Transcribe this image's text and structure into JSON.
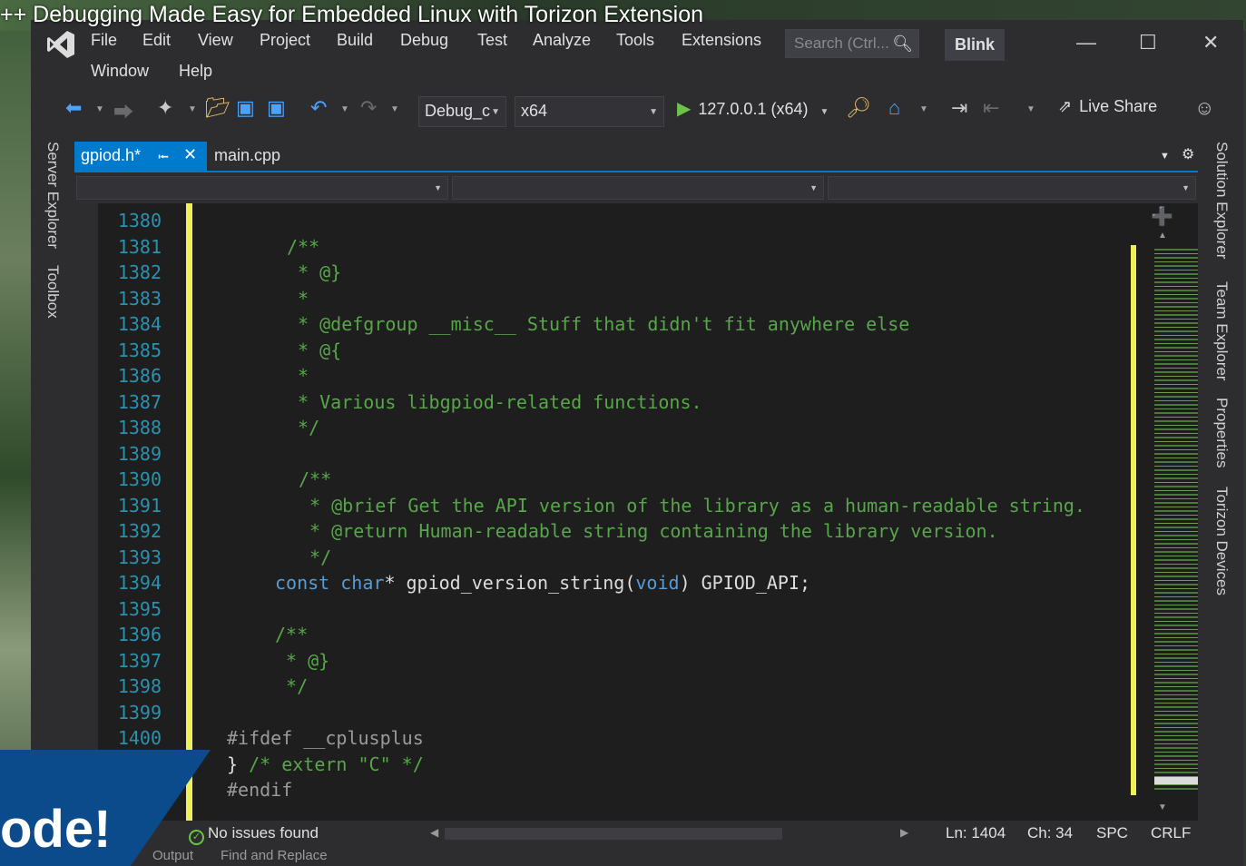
{
  "video": {
    "title": "++ Debugging Made Easy for Embedded Linux with Torizon Extension",
    "overlay_text": "ode!"
  },
  "menu": {
    "row1": [
      "File",
      "Edit",
      "View",
      "Project",
      "Build",
      "Debug",
      "Test",
      "Analyze",
      "Tools",
      "Extensions"
    ],
    "row2": [
      "Window",
      "Help"
    ]
  },
  "search": {
    "placeholder": "Search (Ctrl..."
  },
  "solution_name": "Blink",
  "toolbar": {
    "config": "Debug_c",
    "platform": "x64",
    "run_target": "127.0.0.1 (x64)",
    "live_share": "Live Share"
  },
  "left_rail": [
    "Server Explorer",
    "Toolbox"
  ],
  "right_rail": [
    "Solution Explorer",
    "Team Explorer",
    "Properties",
    "Torizon Devices"
  ],
  "tabs": {
    "active": "gpiod.h*",
    "inactive": "main.cpp"
  },
  "editor": {
    "lines": [
      {
        "no": "1380",
        "text": "",
        "cls": "c-txt",
        "indent": 0
      },
      {
        "no": "1381",
        "text": "/**",
        "cls": "c-comment",
        "indent": 84
      },
      {
        "no": "1382",
        "text": " * @}",
        "cls": "c-comment",
        "indent": 84
      },
      {
        "no": "1383",
        "text": " *",
        "cls": "c-comment",
        "indent": 84
      },
      {
        "no": "1384",
        "text": " * @defgroup __misc__ Stuff that didn't fit anywhere else",
        "cls": "c-comment",
        "indent": 84
      },
      {
        "no": "1385",
        "text": " * @{",
        "cls": "c-comment",
        "indent": 84
      },
      {
        "no": "1386",
        "text": " *",
        "cls": "c-comment",
        "indent": 84
      },
      {
        "no": "1387",
        "text": " * Various libgpiod-related functions.",
        "cls": "c-comment",
        "indent": 84
      },
      {
        "no": "1388",
        "text": " */",
        "cls": "c-comment",
        "indent": 84
      },
      {
        "no": "1389",
        "text": "",
        "cls": "c-txt",
        "indent": 0
      },
      {
        "no": "1390",
        "text": "/**",
        "cls": "c-comment",
        "indent": 97
      },
      {
        "no": "1391",
        "text": " * @brief Get the API version of the library as a human-readable string.",
        "cls": "c-comment",
        "indent": 97
      },
      {
        "no": "1392",
        "text": " * @return Human-readable string containing the library version.",
        "cls": "c-comment",
        "indent": 97
      },
      {
        "no": "1393",
        "text": " */",
        "cls": "c-comment",
        "indent": 97
      },
      {
        "no": "1394",
        "text": "",
        "cls": "c-txt",
        "indent": 71,
        "rich": true
      },
      {
        "no": "1395",
        "text": "",
        "cls": "c-txt",
        "indent": 0
      },
      {
        "no": "1396",
        "text": "/**",
        "cls": "c-comment",
        "indent": 71
      },
      {
        "no": "1397",
        "text": " * @}",
        "cls": "c-comment",
        "indent": 71
      },
      {
        "no": "1398",
        "text": " */",
        "cls": "c-comment",
        "indent": 71
      },
      {
        "no": "1399",
        "text": "",
        "cls": "c-txt",
        "indent": 0
      },
      {
        "no": "1400",
        "text": "#ifdef __cplusplus",
        "cls": "c-pp",
        "indent": 18
      },
      {
        "no": "",
        "text": "",
        "cls": "c-txt",
        "indent": 18,
        "rich2": true
      },
      {
        "no": "",
        "text": "#endif",
        "cls": "c-pp",
        "indent": 18
      }
    ],
    "line1394": {
      "kw1": "const",
      "kw2": "char",
      "rest1": "* gpiod_version_string(",
      "kw3": "void",
      "rest2": ") GPIOD_API;"
    },
    "line1401": {
      "brace": "} ",
      "comment": "/* extern \"C\" */"
    }
  },
  "status": {
    "issues": "No issues found",
    "ln": "Ln: 1404",
    "ch": "Ch: 34",
    "spc": "SPC",
    "crlf": "CRLF"
  },
  "bottom_tabs": [
    "Output",
    "Find and Replace"
  ],
  "colors": {
    "accent": "#007acc",
    "comment": "#57a64a",
    "keyword": "#569cd6",
    "lineno": "#2b91af",
    "change_bar": "#efef5a"
  }
}
